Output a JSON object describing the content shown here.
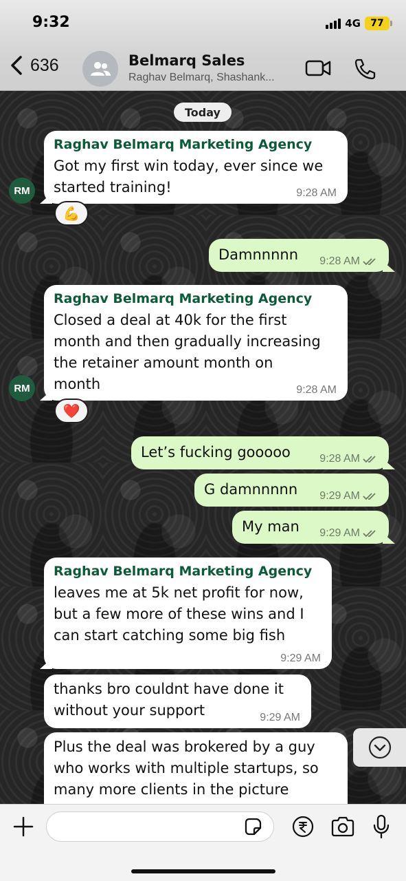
{
  "status": {
    "time": "9:32",
    "network": "4G",
    "battery": "77"
  },
  "header": {
    "back_count": "636",
    "title": "Belmarq Sales",
    "subtitle": "Raghav Belmarq, Shashank..."
  },
  "chat": {
    "day_label": "Today",
    "messages": [
      {
        "sender": "Raghav Belmarq Marketing Agency",
        "text": "Got my first win today, ever since we\nstarted training!",
        "time": "9:28 AM",
        "avatar": "RM",
        "reaction": "💪"
      },
      {
        "text": "Damnnnnn",
        "time": "9:28 AM"
      },
      {
        "sender": "Raghav Belmarq Marketing Agency",
        "text": "Closed a deal at 40k for the first\nmonth and then gradually increasing\nthe retainer amount month on\nmonth",
        "time": "9:28 AM",
        "avatar": "RM",
        "reaction": "❤️"
      },
      {
        "text": "Let’s fucking gooooo",
        "time": "9:28 AM"
      },
      {
        "text": "G damnnnnn",
        "time": "9:29 AM"
      },
      {
        "text": "My man",
        "time": "9:29 AM"
      },
      {
        "sender": "Raghav Belmarq Marketing Agency",
        "text": "leaves me at 5k net profit for now,\nbut a few more of these wins and I\ncan start catching some big fish",
        "time": "9:29 AM"
      },
      {
        "text": "thanks bro couldnt have done it\nwithout your support",
        "time": "9:29 AM"
      },
      {
        "text": "Plus the deal was brokered by a guy\nwho works with multiple startups, so\nmany more clients in the picture"
      }
    ]
  },
  "composer": {
    "value": ""
  },
  "colors": {
    "outgoing": "#dcf8c6",
    "incoming": "#ffffff",
    "sender_name": "#0d5a3a",
    "avatar": "#1f5c3f"
  }
}
